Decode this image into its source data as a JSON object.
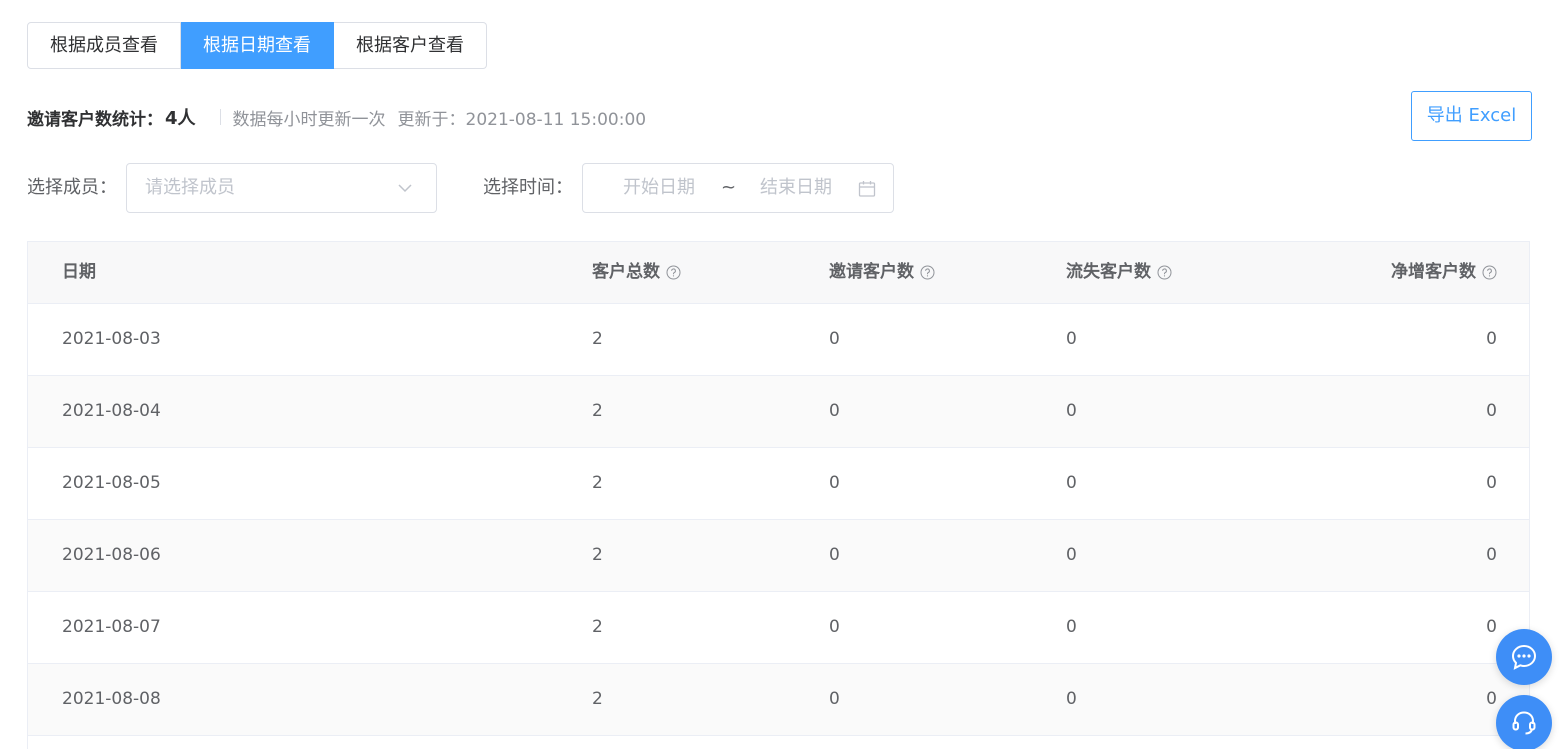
{
  "tabs": [
    {
      "label": "根据成员查看",
      "active": false
    },
    {
      "label": "根据日期查看",
      "active": true
    },
    {
      "label": "根据客户查看",
      "active": false
    }
  ],
  "stats": {
    "label": "邀请客户数统计：",
    "value": "4人",
    "note": "数据每小时更新一次",
    "updated": "更新于：2021-08-11 15:00:00"
  },
  "export_label": "导出 Excel",
  "filters": {
    "member_label": "选择成员：",
    "member_placeholder": "请选择成员",
    "time_label": "选择时间：",
    "start_placeholder": "开始日期",
    "range_separator": "~",
    "end_placeholder": "结束日期"
  },
  "table": {
    "columns": [
      "日期",
      "客户总数",
      "邀请客户数",
      "流失客户数",
      "净增客户数"
    ],
    "rows": [
      [
        "2021-08-03",
        "2",
        "0",
        "0",
        "0"
      ],
      [
        "2021-08-04",
        "2",
        "0",
        "0",
        "0"
      ],
      [
        "2021-08-05",
        "2",
        "0",
        "0",
        "0"
      ],
      [
        "2021-08-06",
        "2",
        "0",
        "0",
        "0"
      ],
      [
        "2021-08-07",
        "2",
        "0",
        "0",
        "0"
      ],
      [
        "2021-08-08",
        "2",
        "0",
        "0",
        "0"
      ]
    ]
  },
  "icons": {
    "chevron": "chevron-down-icon",
    "calendar": "calendar-icon",
    "help": "question-circle-icon",
    "chat": "chat-bubble-icon",
    "support": "headset-icon"
  },
  "colors": {
    "primary": "#409eff",
    "fab": "#3e8ef7",
    "header_bg": "#f8f8f9",
    "stripe_bg": "#fafafa"
  }
}
